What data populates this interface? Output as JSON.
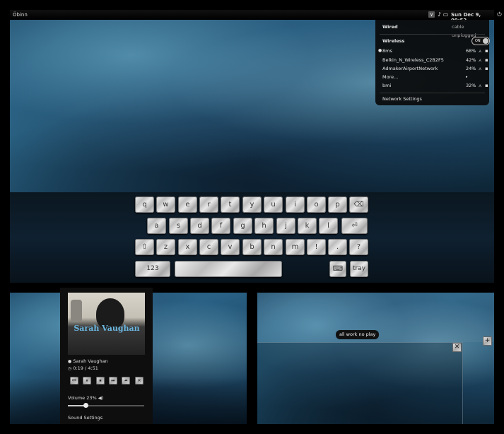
{
  "topbar": {
    "title": "Öbinn",
    "clock": "Sun Dec 9, 09:52",
    "icons": [
      "network-icon",
      "music-icon",
      "battery-icon",
      "power-icon"
    ]
  },
  "network_menu": {
    "wired_label": "Wired",
    "wired_status": "cable unplugged",
    "wireless_label": "Wireless",
    "toggle_label": "ON",
    "networks": [
      {
        "name": "8ms",
        "strength": "68%",
        "active": true
      },
      {
        "name": "Belkin_N_Wireless_C2B2F5",
        "strength": "42%",
        "active": false
      },
      {
        "name": "AdmakerAirportNetwork",
        "strength": "24%",
        "active": false
      },
      {
        "name": "bmi",
        "strength": "32%",
        "active": false
      }
    ],
    "more_label": "More...",
    "settings_label": "Network Settings"
  },
  "keyboard": {
    "row1": [
      "q",
      "w",
      "e",
      "r",
      "t",
      "y",
      "u",
      "i",
      "o",
      "p",
      "⌫"
    ],
    "row2": [
      "a",
      "s",
      "d",
      "f",
      "g",
      "h",
      "j",
      "k",
      "l",
      "⏎"
    ],
    "row3": [
      "⇧",
      "z",
      "x",
      "c",
      "v",
      "b",
      "n",
      "m",
      "!",
      ".",
      "?"
    ],
    "numbers_label": "123",
    "tray_label": "tray",
    "keyboard_icon": "⌨"
  },
  "player": {
    "album_text": "Sarah Vaughan",
    "artist": "Sarah Vaughan",
    "time": "0:19 / 4:51",
    "volume_label": "Volume 23%",
    "volume_level": 0.23,
    "sound_settings": "Sound Settings",
    "controls": [
      "⏮",
      "⏸",
      "⏹",
      "⏭",
      "⏶",
      "✕"
    ]
  },
  "workspace": {
    "tooltip": "all work no play",
    "close_symbol": "✕",
    "plus_symbol": "+"
  }
}
